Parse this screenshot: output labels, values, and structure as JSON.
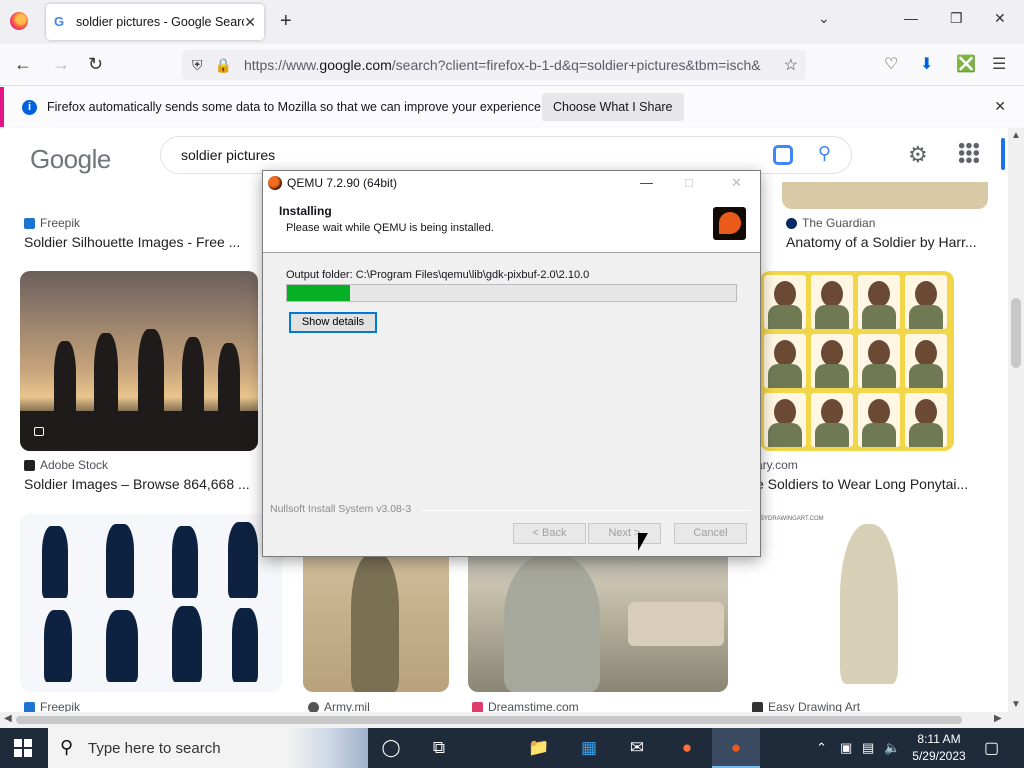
{
  "browser": {
    "tab_title": "soldier pictures - Google Search",
    "tab_close": "✕",
    "new_tab": "+",
    "url_prefix": "https://www.",
    "url_host": "google.com",
    "url_rest": "/search?client=firefox-b-1-d&q=soldier+pictures&tbm=isch&",
    "notification_text": "Firefox automatically sends some data to Mozilla so that we can improve your experience.",
    "notification_button": "Choose What I Share"
  },
  "google": {
    "logo": "Google",
    "search_query": "soldier pictures",
    "results": [
      {
        "source": "Freepik",
        "title": "Soldier Silhouette Images - Free ..."
      },
      {
        "source": "The Guardian",
        "title": "Anatomy of a Soldier by Harr..."
      },
      {
        "source": "Adobe Stock",
        "title": "Soldier Images – Browse 864,668 ..."
      },
      {
        "source": "ary.com",
        "title": "e Soldiers to Wear Long Ponytai..."
      },
      {
        "source": "Freepik",
        "title": ""
      },
      {
        "source": "Army.mil",
        "title": ""
      },
      {
        "source": "Dreamstime.com",
        "title": ""
      },
      {
        "source": "Easy Drawing Art",
        "title": ""
      }
    ],
    "watermark": "EASYDRAWINGART.COM"
  },
  "installer": {
    "window_title": "QEMU 7.2.90 (64bit)",
    "heading": "Installing",
    "subheading": "Please wait while QEMU is being installed.",
    "output_folder": "Output folder: C:\\Program Files\\qemu\\lib\\gdk-pixbuf-2.0\\2.10.0",
    "progress": 0.14,
    "show_details": "Show details",
    "branding": "Nullsoft Install System v3.08-3",
    "back": "< Back",
    "next": "Next >",
    "cancel": "Cancel"
  },
  "taskbar": {
    "search_placeholder": "Type here to search",
    "time": "8:11 AM",
    "date": "5/29/2023"
  },
  "colors": {
    "firefox_accent": "#e31587",
    "google_blue": "#4285f4",
    "progress_green": "#06b025",
    "taskbar_bg": "#1f2b3b"
  }
}
